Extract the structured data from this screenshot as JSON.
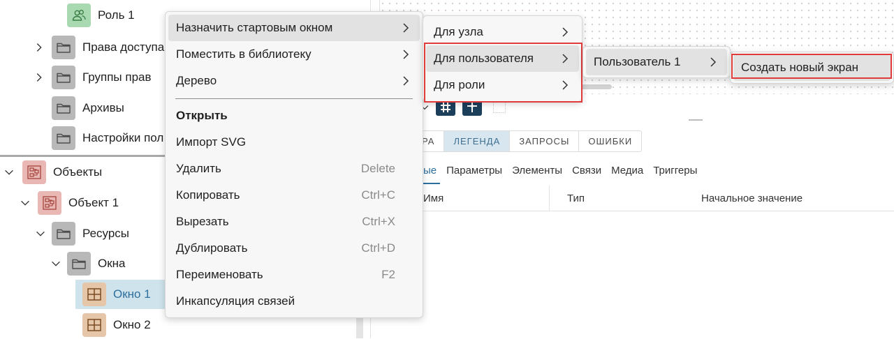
{
  "tree": {
    "items": [
      {
        "label": "Роль 1",
        "icon": "role-icon"
      },
      {
        "label": "Права доступа",
        "icon": "folder-icon"
      },
      {
        "label": "Группы прав",
        "icon": "folder-icon"
      },
      {
        "label": "Архивы",
        "icon": "folder-icon"
      },
      {
        "label": "Настройки пол",
        "icon": "folder-icon"
      },
      {
        "label": "Объекты",
        "icon": "object-icon"
      },
      {
        "label": "Объект 1",
        "icon": "object-icon"
      },
      {
        "label": "Ресурсы",
        "icon": "folder-icon"
      },
      {
        "label": "Окна",
        "icon": "folder-icon"
      },
      {
        "label": "Окно 1",
        "icon": "window-icon"
      },
      {
        "label": "Окно 2",
        "icon": "window-icon"
      }
    ]
  },
  "panel": {
    "tabs": [
      "РА",
      "ЛЕГЕНДА",
      "ЗАПРОСЫ",
      "ОШИБКИ"
    ],
    "active_tab": "ЛЕГЕНДА",
    "subtabs": [
      "ые",
      "Параметры",
      "Элементы",
      "Связи",
      "Медиа",
      "Триггеры"
    ],
    "columns": [
      "Имя",
      "Тип",
      "Начальное значение"
    ]
  },
  "context_menu": {
    "items": [
      {
        "label": "Назначить стартовым окном",
        "submenu": true
      },
      {
        "label": "Поместить в библиотеку",
        "submenu": true
      },
      {
        "label": "Дерево",
        "submenu": true
      },
      {
        "label": "Открыть"
      },
      {
        "label": "Импорт SVG"
      },
      {
        "label": "Удалить",
        "shortcut": "Delete"
      },
      {
        "label": "Копировать",
        "shortcut": "Ctrl+C"
      },
      {
        "label": "Вырезать",
        "shortcut": "Ctrl+X"
      },
      {
        "label": "Дублировать",
        "shortcut": "Ctrl+D"
      },
      {
        "label": "Переименовать",
        "shortcut": "F2"
      },
      {
        "label": "Инкапсуляция связей"
      }
    ]
  },
  "submenu1": {
    "items": [
      "Для узла",
      "Для пользователя",
      "Для роли"
    ]
  },
  "submenu2": {
    "items": [
      "Пользователь 1"
    ]
  },
  "submenu3": {
    "items": [
      "Создать новый экран"
    ]
  },
  "colors": {
    "accent": "#2d6f9e",
    "highlight_box": "#e03a3a",
    "selected_row": "#cfe3ec"
  }
}
